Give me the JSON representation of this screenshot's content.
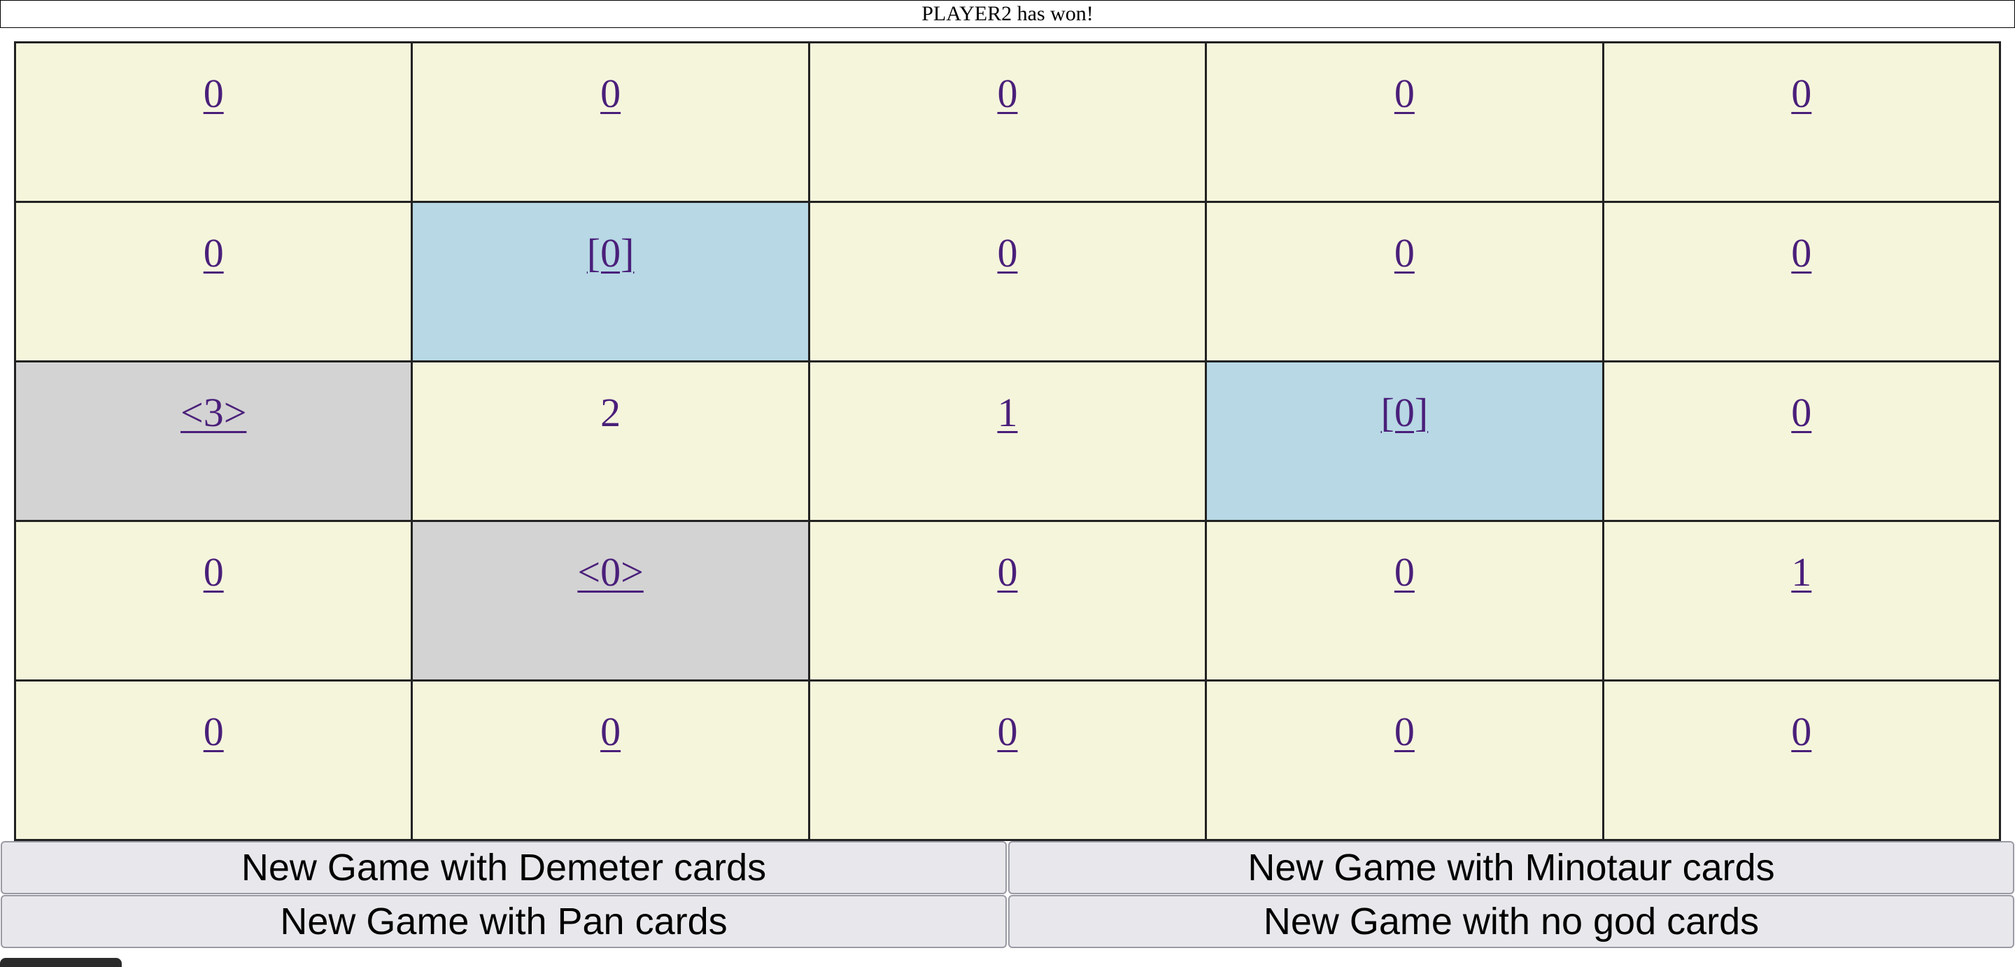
{
  "status": {
    "message": "PLAYER2 has won!"
  },
  "board": {
    "rows": [
      [
        {
          "label": "0",
          "link": true,
          "state": "normal"
        },
        {
          "label": "0",
          "link": true,
          "state": "normal"
        },
        {
          "label": "0",
          "link": true,
          "state": "normal"
        },
        {
          "label": "0",
          "link": true,
          "state": "normal"
        },
        {
          "label": "0",
          "link": true,
          "state": "normal"
        }
      ],
      [
        {
          "label": "0",
          "link": true,
          "state": "normal"
        },
        {
          "label": "[0]",
          "link": true,
          "state": "blue"
        },
        {
          "label": "0",
          "link": true,
          "state": "normal"
        },
        {
          "label": "0",
          "link": true,
          "state": "normal"
        },
        {
          "label": "0",
          "link": true,
          "state": "normal"
        }
      ],
      [
        {
          "label": "<3>",
          "link": true,
          "state": "gray"
        },
        {
          "label": "2",
          "link": false,
          "state": "normal"
        },
        {
          "label": "1",
          "link": true,
          "state": "normal"
        },
        {
          "label": "[0]",
          "link": true,
          "state": "blue"
        },
        {
          "label": "0",
          "link": true,
          "state": "normal"
        }
      ],
      [
        {
          "label": "0",
          "link": true,
          "state": "normal"
        },
        {
          "label": "<0>",
          "link": true,
          "state": "gray"
        },
        {
          "label": "0",
          "link": true,
          "state": "normal"
        },
        {
          "label": "0",
          "link": true,
          "state": "normal"
        },
        {
          "label": "1",
          "link": true,
          "state": "normal"
        }
      ],
      [
        {
          "label": "0",
          "link": true,
          "state": "normal"
        },
        {
          "label": "0",
          "link": true,
          "state": "normal"
        },
        {
          "label": "0",
          "link": true,
          "state": "normal"
        },
        {
          "label": "0",
          "link": true,
          "state": "normal"
        },
        {
          "label": "0",
          "link": true,
          "state": "normal"
        }
      ]
    ],
    "colors": {
      "normal": "#f5f5dc",
      "blue": "#b7d8e4",
      "gray": "#d3d3d3",
      "link": "#4a1f7a"
    }
  },
  "buttons": {
    "demeter": "New Game with Demeter cards",
    "minotaur": "New Game with Minotaur cards",
    "pan": "New Game with Pan cards",
    "no_god": "New Game with no god cards"
  }
}
